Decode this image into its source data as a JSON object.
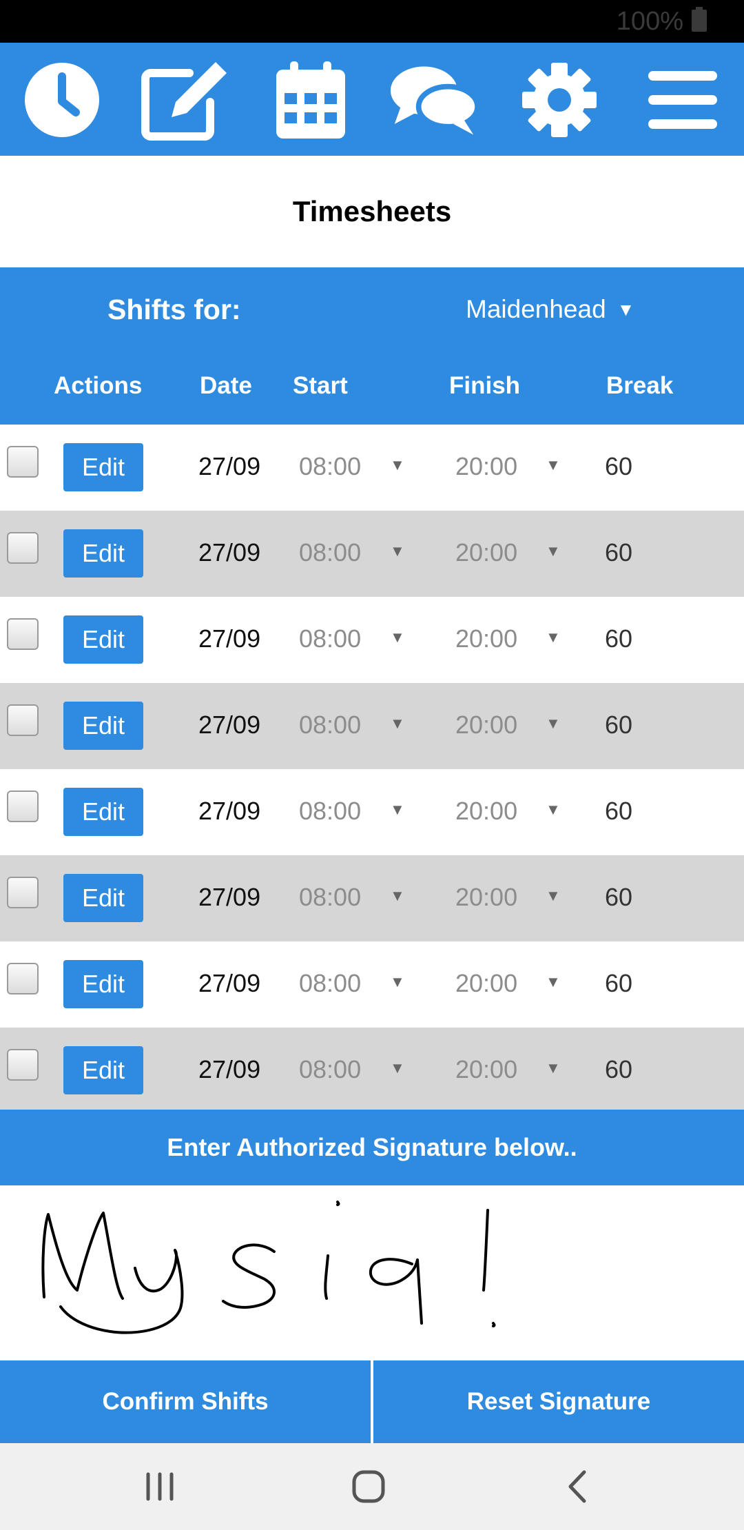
{
  "status_bar": {
    "battery": "100%"
  },
  "nav": {
    "icons": [
      "clock-icon",
      "edit-note-icon",
      "calendar-icon",
      "chat-icon",
      "gear-icon",
      "menu-icon"
    ]
  },
  "page": {
    "title": "Timesheets"
  },
  "filters": {
    "shifts_for_label": "Shifts for:",
    "location": "Maidenhead"
  },
  "table": {
    "columns": [
      "Actions",
      "Date",
      "Start",
      "Finish",
      "Break"
    ],
    "rows": [
      {
        "edit_label": "Edit",
        "date": "27/09",
        "start": "08:00",
        "finish": "20:00",
        "break": "60"
      },
      {
        "edit_label": "Edit",
        "date": "27/09",
        "start": "08:00",
        "finish": "20:00",
        "break": "60"
      },
      {
        "edit_label": "Edit",
        "date": "27/09",
        "start": "08:00",
        "finish": "20:00",
        "break": "60"
      },
      {
        "edit_label": "Edit",
        "date": "27/09",
        "start": "08:00",
        "finish": "20:00",
        "break": "60"
      },
      {
        "edit_label": "Edit",
        "date": "27/09",
        "start": "08:00",
        "finish": "20:00",
        "break": "60"
      },
      {
        "edit_label": "Edit",
        "date": "27/09",
        "start": "08:00",
        "finish": "20:00",
        "break": "60"
      },
      {
        "edit_label": "Edit",
        "date": "27/09",
        "start": "08:00",
        "finish": "20:00",
        "break": "60"
      },
      {
        "edit_label": "Edit",
        "date": "27/09",
        "start": "08:00",
        "finish": "20:00",
        "break": "60"
      }
    ]
  },
  "signature": {
    "prompt": "Enter Authorized Signature below..",
    "handwritten_text": "MySig!"
  },
  "actions": {
    "confirm_label": "Confirm Shifts",
    "reset_label": "Reset Signature"
  },
  "colors": {
    "primary": "#2f8be0",
    "row_alt": "#d6d6d6",
    "nav_bar": "#f0f0f0"
  }
}
